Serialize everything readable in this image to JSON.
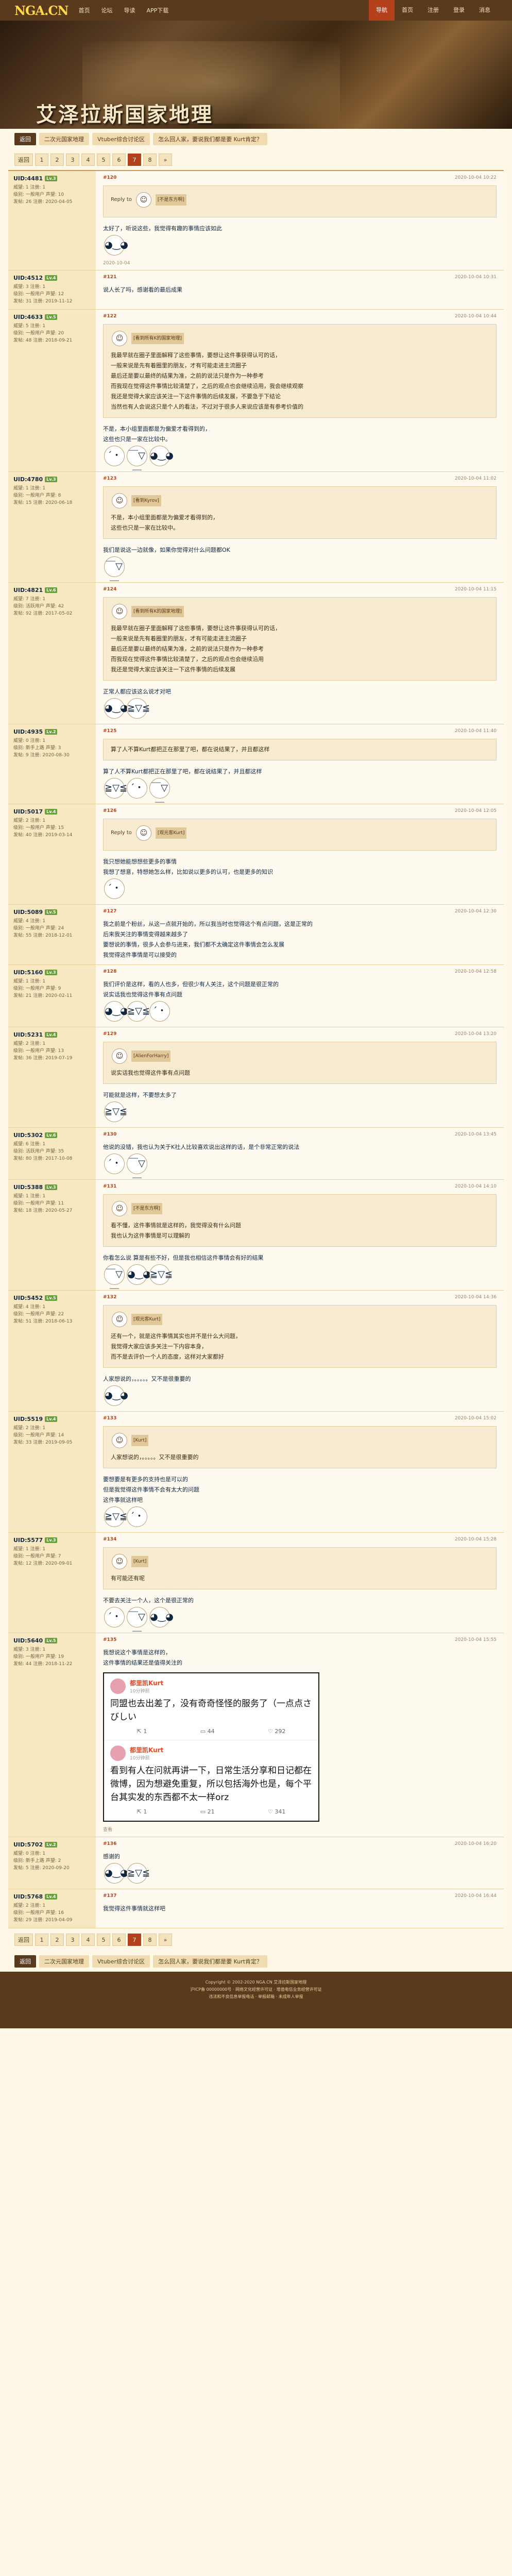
{
  "header": {
    "logo": "NGA.CN",
    "logo_sub": "艾泽拉斯国家地理",
    "nav": [
      "首页",
      "论坛",
      "导读",
      "APP下载"
    ],
    "right": [
      "导航",
      "首页",
      "注册",
      "登录",
      "消息"
    ]
  },
  "banner": {
    "title": "艾泽拉斯国家地理"
  },
  "forum_tabs": [
    "返回",
    "二次元国家地理",
    "Vtuber综合讨论区",
    "怎么回人家，要说我们都是要 Kurt肯定？"
  ],
  "pager": {
    "label": "返回",
    "pages": [
      "1",
      "2",
      "3",
      "4",
      "5",
      "6",
      "7",
      "8"
    ],
    "current": "7",
    "next": "»"
  },
  "posts": [
    {
      "user": "UID:4481",
      "badge": "Lv.3",
      "stats": [
        "威望: 1  注册: 1",
        "级别: 一般用户  声望: 10",
        "发帖: 26 注册: 2020-04-05"
      ],
      "floor": "#120",
      "time": "2020-10-04 10:22",
      "quote_head": "Reply to",
      "quote_user": "[不是东方啊]",
      "text": "太好了，听说这些，我觉得有趣的事情应该如此",
      "foot": "2020-10-04"
    },
    {
      "user": "UID:4512",
      "badge": "Lv.4",
      "stats": [
        "威望: 3  注册: 1",
        "级别: 一般用户  声望: 12",
        "发帖: 31 注册: 2019-11-12"
      ],
      "floor": "#121",
      "time": "2020-10-04 10:31",
      "text": "说人长了吗，感谢看的最后成果",
      "foot": ""
    },
    {
      "user": "UID:4633",
      "badge": "Lv.5",
      "stats": [
        "威望: 5  注册: 1",
        "级别: 一般用户  声望: 20",
        "发帖: 48 注册: 2018-09-21"
      ],
      "floor": "#122",
      "time": "2020-10-04 10:44",
      "quote_user": "[看到所有K的国家地理]",
      "quote_lines": [
        "我最早就在圈子里面解释了这些事情，要想让这件事获得认可的话，",
        "一般来说是先有着圈里的朋友，才有可能走进主流圈子",
        "最后还是要以最终的结果为准，之前的说法只是作为一种参考",
        "而我现在觉得这件事情比较清楚了，之后的观点也会继续沿用，我会继续观察",
        "我还是觉得大家应该关注一下这件事情的后续发展，不要急于下结论",
        "当然也有人会说这只是个人的看法，不过对于很多人来说应该是有参考价值的"
      ],
      "text_lines": [
        "不是，本小组里面都是为偏爱才看得到的，",
        "这些也只是一家在比较中。"
      ],
      "foot": ""
    },
    {
      "user": "UID:4780",
      "badge": "Lv.3",
      "stats": [
        "威望: 1  注册: 1",
        "级别: 一般用户  声望: 8",
        "发帖: 15 注册: 2020-06-18"
      ],
      "floor": "#123",
      "time": "2020-10-04 11:02",
      "quote_user": "[看到Kyrov]",
      "quote_lines": [
        "不是，本小组里面都是为偏爱才看得到的，",
        "这些也只是一家在比较中。"
      ],
      "text": "我们是说这一边就像，如果你觉得对什么问题都OK",
      "foot": ""
    },
    {
      "user": "UID:4821",
      "badge": "Lv.6",
      "stats": [
        "威望: 7  注册: 1",
        "级别: 活跃用户  声望: 42",
        "发帖: 92 注册: 2017-05-02"
      ],
      "floor": "#124",
      "time": "2020-10-04 11:15",
      "quote_user": "[看到所有K的国家地理]",
      "quote_lines": [
        "我最早就在圈子里面解释了这些事情，要想让这件事获得认可的话，",
        "一般来说是先有着圈里的朋友，才有可能走进主流圈子",
        "最后还是要以最终的结果为准，之前的说法只是作为一种参考",
        "而我现在觉得这件事情比较清楚了，之后的观点也会继续沿用",
        "我还是觉得大家应该关注一下这件事情的后续发展"
      ],
      "text": "正常人都应该这么说才对吧",
      "foot": ""
    },
    {
      "user": "UID:4935",
      "badge": "Lv.2",
      "stats": [
        "威望: 0  注册: 1",
        "级别: 新手上路  声望: 3",
        "发帖: 9 注册: 2020-08-30"
      ],
      "floor": "#125",
      "time": "2020-10-04 11:40",
      "text": "算了人不算Kurt都把正在那里了吧，都在说结果了，并且都这样",
      "quote_lines": [
        "算了人不算Kurt都把正在那里了吧，都在说结果了，并且都这样"
      ],
      "foot": ""
    },
    {
      "user": "UID:5017",
      "badge": "Lv.4",
      "stats": [
        "威望: 2  注册: 1",
        "级别: 一般用户  声望: 15",
        "发帖: 40 注册: 2019-03-14"
      ],
      "floor": "#126",
      "time": "2020-10-04 12:05",
      "quote_head": "Reply to",
      "quote_user": "[观光客Kurt]",
      "text_lines": [
        "我只想她能想想些更多的事情",
        "",
        "我想了想意，特想她怎么样，比如说以更多的认可，也是更多的知识"
      ],
      "foot": ""
    },
    {
      "user": "UID:5089",
      "badge": "Lv.5",
      "stats": [
        "威望: 4  注册: 1",
        "级别: 一般用户  声望: 24",
        "发帖: 55 注册: 2018-12-01"
      ],
      "floor": "#127",
      "time": "2020-10-04 12:30",
      "text_lines": [
        "我之前是个粉丝，从这一点就开始的，所以我当时也觉得这个有点问题，这是正常的",
        "后来我关注的事情变得越来越多了",
        "",
        "要想说的事情，很多人会参与进来，我们都不太确定这件事情会怎么发展",
        "我觉得这件事情是可以接受的"
      ],
      "foot": ""
    },
    {
      "user": "UID:5160",
      "badge": "Lv.3",
      "stats": [
        "威望: 1  注册: 1",
        "级别: 一般用户  声望: 9",
        "发帖: 21 注册: 2020-02-11"
      ],
      "floor": "#128",
      "time": "2020-10-04 12:58",
      "text_lines": [
        "我们评价是这样，看的人也多，但很少有人关注，这个问题是很正常的",
        "",
        "说实话我也觉得这件事有点问题"
      ],
      "foot": ""
    },
    {
      "user": "UID:5231",
      "badge": "Lv.4",
      "stats": [
        "威望: 2  注册: 1",
        "级别: 一般用户  声望: 13",
        "发帖: 36 注册: 2019-07-19"
      ],
      "floor": "#129",
      "time": "2020-10-04 13:20",
      "quote_user": "[AlienForHarry]",
      "quote_lines": [
        "说实话我也觉得这件事有点问题"
      ],
      "text": "可能就是这样，不要想太多了",
      "foot": ""
    },
    {
      "user": "UID:5302",
      "badge": "Lv.6",
      "stats": [
        "威望: 6  注册: 1",
        "级别: 活跃用户  声望: 35",
        "发帖: 80 注册: 2017-10-08"
      ],
      "floor": "#130",
      "time": "2020-10-04 13:45",
      "text": "他说的没错，我也认为关于K社人比较喜欢说出这样的话，是个非常正常的说法",
      "foot": ""
    },
    {
      "user": "UID:5388",
      "badge": "Lv.3",
      "stats": [
        "威望: 1  注册: 1",
        "级别: 一般用户  声望: 11",
        "发帖: 18 注册: 2020-05-27"
      ],
      "floor": "#131",
      "time": "2020-10-04 14:10",
      "quote_user": "[不是东方啊]",
      "quote_lines": [
        "看不懂，这件事情就是这样的，我觉得没有什么问题",
        "我也认为这件事情是可以理解的"
      ],
      "text": "你看怎么说 算是有些不好，但是我也相信这件事情会有好的结果",
      "foot": ""
    },
    {
      "user": "UID:5452",
      "badge": "Lv.5",
      "stats": [
        "威望: 4  注册: 1",
        "级别: 一般用户  声望: 22",
        "发帖: 51 注册: 2018-06-13"
      ],
      "floor": "#132",
      "time": "2020-10-04 14:36",
      "quote_user": "[观光客Kurt]",
      "quote_lines": [
        "还有一个，就是这件事情其实也并不是什么大问题，",
        "我觉得大家应该多关注一下内容本身，",
        "而不是去评价一个人的态度，这样对大家都好"
      ],
      "text": "人家想说的，。。。。。又不是很重要的",
      "foot": ""
    },
    {
      "user": "UID:5519",
      "badge": "Lv.4",
      "stats": [
        "威望: 2  注册: 1",
        "级别: 一般用户  声望: 14",
        "发帖: 33 注册: 2019-09-05"
      ],
      "floor": "#133",
      "time": "2020-10-04 15:02",
      "quote_user": "[Kurt]",
      "quote_lines": [
        "人家想说的，。。。。。又不是很重要的"
      ],
      "text_lines": [
        "要想要是有更多的支持也是可以的",
        "但是我觉得这件事情不会有太大的问题",
        "",
        "这件事就这样吧"
      ],
      "foot": ""
    },
    {
      "user": "UID:5577",
      "badge": "Lv.3",
      "stats": [
        "威望: 1  注册: 1",
        "级别: 一般用户  声望: 7",
        "发帖: 12 注册: 2020-09-01"
      ],
      "floor": "#134",
      "time": "2020-10-04 15:28",
      "quote_user": "[Kurt]",
      "quote_lines": [
        "有可能还有呢"
      ],
      "text": "不要去关注一个人，这个是很正常的",
      "foot": ""
    },
    {
      "user": "UID:5640",
      "badge": "Lv.5",
      "stats": [
        "威望: 3  注册: 1",
        "级别: 一般用户  声望: 19",
        "发帖: 44 注册: 2018-11-22"
      ],
      "floor": "#135",
      "time": "2020-10-04 15:55",
      "text_lines": [
        "我想说这个事情是这样的，",
        "这件事情的结果还是值得关注的"
      ],
      "wcard": [
        {
          "name": "都里凯Kurt",
          "time": "10分钟前",
          "text": "同盟也去出差了，没有奇奇怪怪的服务了（一点点さびしい",
          "stats": [
            "1",
            "44",
            "292"
          ]
        },
        {
          "name": "都里凯Kurt",
          "time": "10分钟前",
          "text": "看到有人在问就再讲一下，日常生活分享和日记都在微博，因为想避免重复，所以包括海外也是，每个平台其实发的东西都不太一样orz",
          "stats": [
            "1",
            "21",
            "341"
          ]
        }
      ],
      "foot": "查看"
    },
    {
      "user": "UID:5702",
      "badge": "Lv.2",
      "stats": [
        "威望: 0  注册: 1",
        "级别: 新手上路  声望: 2",
        "发帖: 5 注册: 2020-09-20"
      ],
      "floor": "#136",
      "time": "2020-10-04 16:20",
      "text": "感谢的",
      "foot": ""
    },
    {
      "user": "UID:5768",
      "badge": "Lv.4",
      "stats": [
        "威望: 2  注册: 1",
        "级别: 一般用户  声望: 16",
        "发帖: 29 注册: 2019-04-09"
      ],
      "floor": "#137",
      "time": "2020-10-04 16:44",
      "text": "我觉得这件事情就这样吧",
      "foot": ""
    }
  ],
  "footer": {
    "lines": [
      "Copyright © 2002-2020 NGA.CN 艾泽拉斯国家地理",
      "沪ICP备 00000000号 · 网络文化经营许可证 · 增值电信业务经营许可证",
      "违法和不良信息举报电话 · 举报邮箱 · 未成年人举报"
    ]
  }
}
